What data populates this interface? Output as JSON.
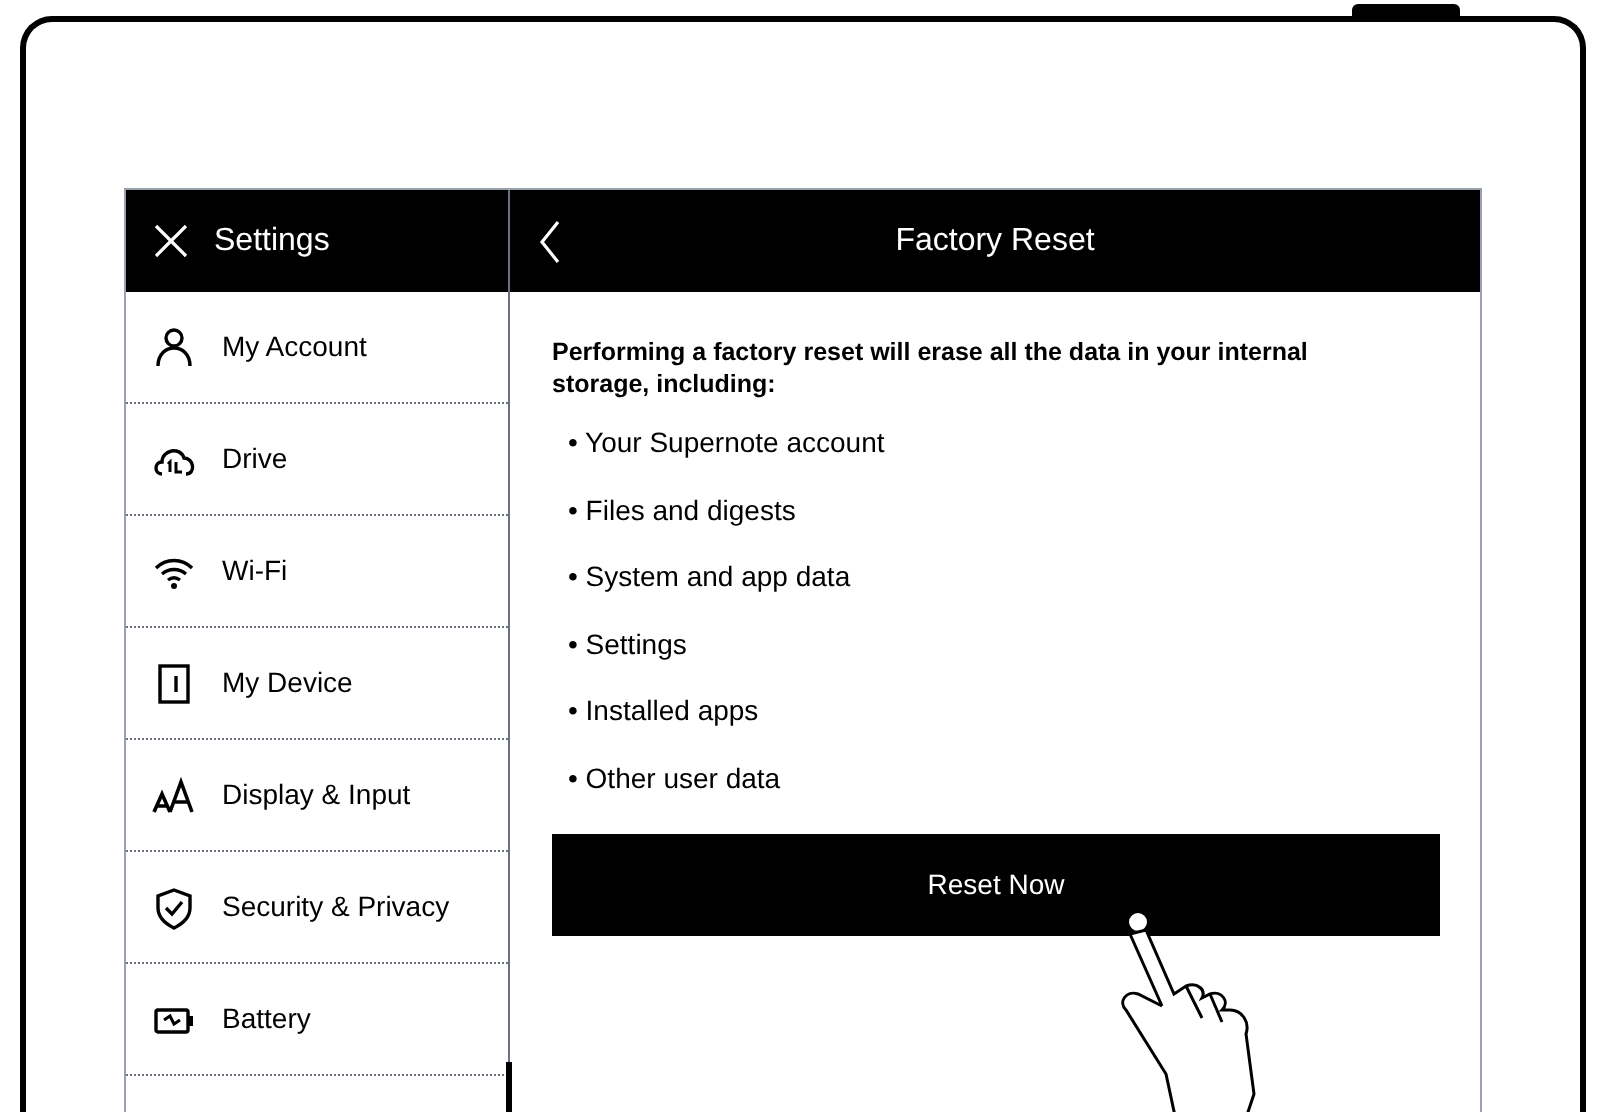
{
  "sidebar": {
    "title": "Settings",
    "items": [
      "My Account",
      "Drive",
      "Wi-Fi",
      "My Device",
      "Display & Input",
      "Security & Privacy",
      "Battery"
    ]
  },
  "page": {
    "title": "Factory Reset",
    "intro": "Performing a factory reset will erase all the data in your internal storage, including:",
    "bullets": [
      "• Your Supernote account",
      "• Files and digests",
      "• System and app data",
      "• Settings",
      "• Installed apps",
      "• Other user data"
    ],
    "button": "Reset Now"
  }
}
